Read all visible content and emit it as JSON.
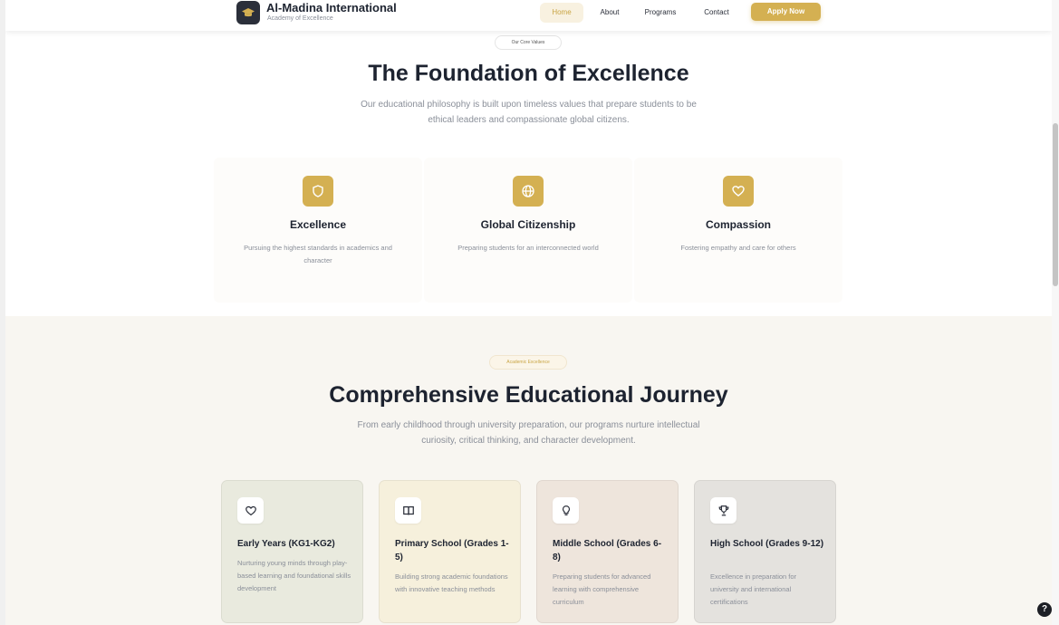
{
  "header": {
    "brand_name": "Al-Madina International",
    "brand_tagline": "Academy of Excellence",
    "nav": {
      "home": "Home",
      "about": "About",
      "programs": "Programs",
      "contact": "Contact"
    },
    "apply_label": "Apply Now"
  },
  "values": {
    "pill": "Our Core Values",
    "title": "The Foundation of Excellence",
    "subtitle_line1": "Our educational philosophy is built upon timeless values that prepare students to be",
    "subtitle_line2": "ethical leaders and compassionate global citizens.",
    "cards": [
      {
        "title": "Excellence",
        "desc": "Pursuing the highest standards in academics and character",
        "icon": "shield-icon"
      },
      {
        "title": "Global Citizenship",
        "desc": "Preparing students for an interconnected world",
        "icon": "globe-icon"
      },
      {
        "title": "Compassion",
        "desc": "Fostering empathy and care for others",
        "icon": "heart-icon"
      }
    ]
  },
  "programs": {
    "pill": "Academic Excellence",
    "title": "Comprehensive Educational Journey",
    "subtitle_line1": "From early childhood through university preparation, our programs nurture intellectual",
    "subtitle_line2": "curiosity, critical thinking, and character development.",
    "cards": [
      {
        "title": "Early Years (KG1-KG2)",
        "desc": "Nurturing young minds through play-based learning and foundational skills development",
        "icon": "heart-icon"
      },
      {
        "title": "Primary School (Grades 1-5)",
        "desc": "Building strong academic foundations with innovative teaching methods",
        "icon": "book-icon"
      },
      {
        "title": "Middle School (Grades 6-8)",
        "desc": "Preparing students for advanced learning with comprehensive curriculum",
        "icon": "lightbulb-icon"
      },
      {
        "title": "High School (Grades 9-12)",
        "desc": "Excellence in preparation for university and international certifications",
        "icon": "trophy-icon"
      }
    ]
  },
  "help_label": "?",
  "colors": {
    "accent": "#d4b052",
    "dark": "#1d2330",
    "muted": "#8a8f99"
  }
}
